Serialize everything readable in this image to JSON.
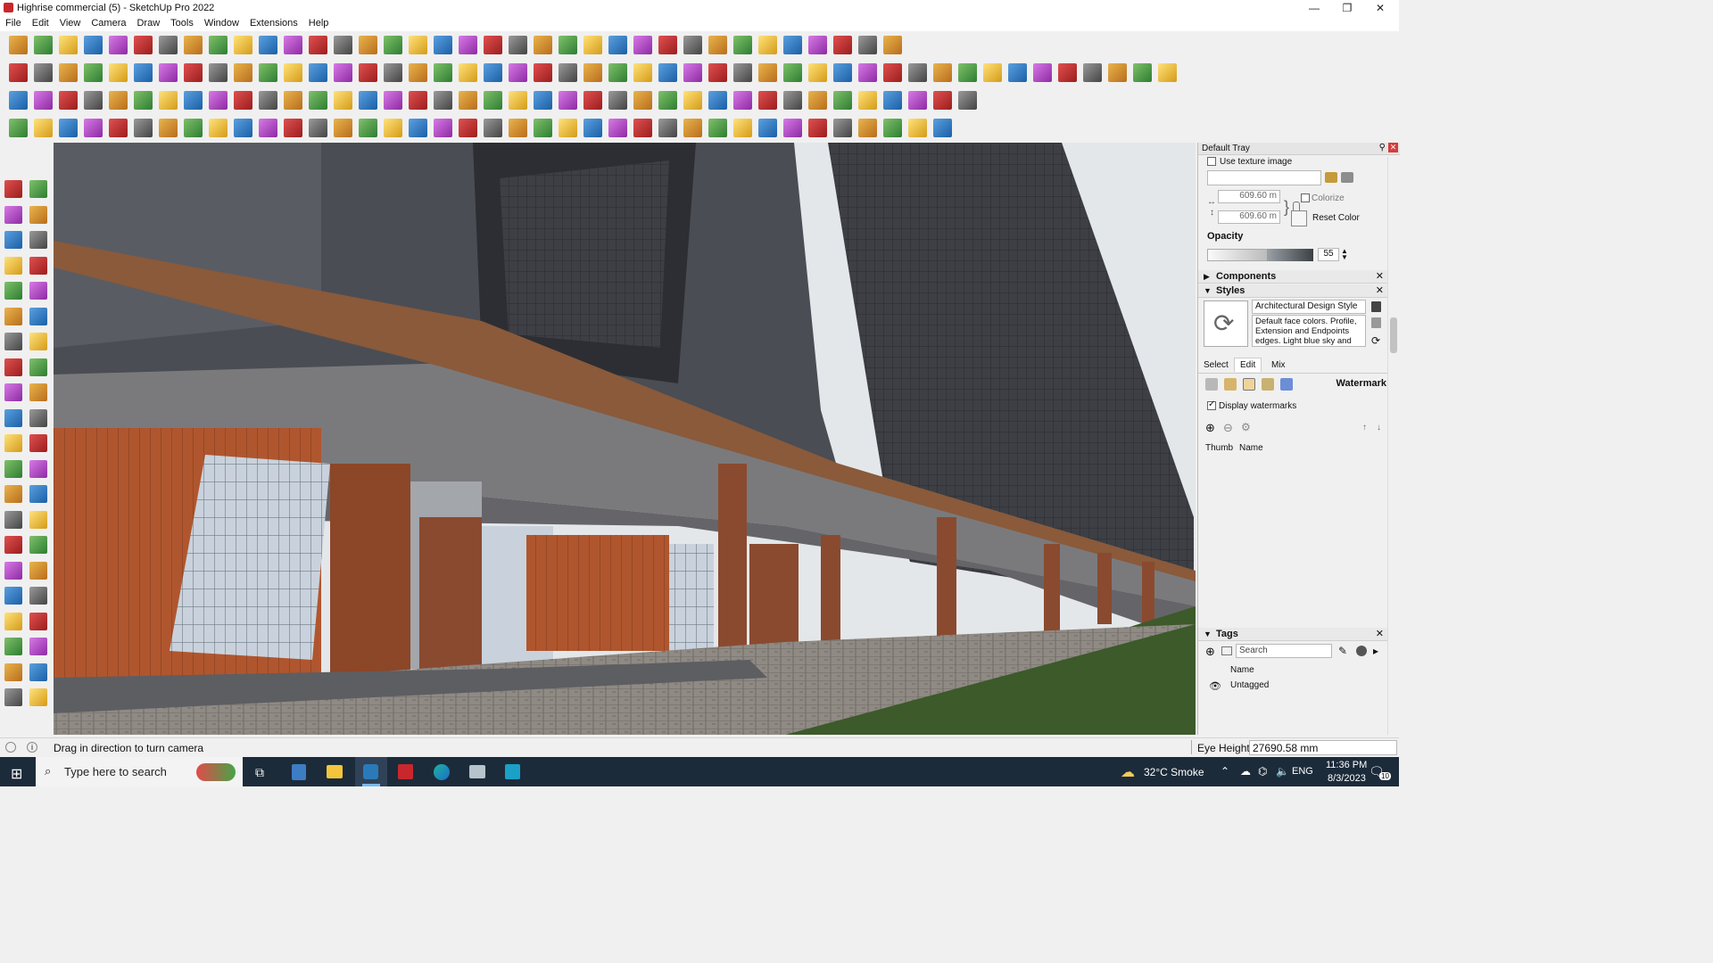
{
  "window": {
    "title": "Highrise commercial (5) - SketchUp Pro 2022",
    "controls": [
      "—",
      "❐",
      "✕"
    ]
  },
  "menu": [
    "File",
    "Edit",
    "View",
    "Camera",
    "Draw",
    "Tools",
    "Window",
    "Extensions",
    "Help"
  ],
  "tray": {
    "title": "Default Tray",
    "materials": {
      "use_texture_label": "Use texture image",
      "width_value": "609.60 m",
      "height_value": "609.60 m",
      "colorize_label": "Colorize",
      "reset_color_label": "Reset Color",
      "opacity_label": "Opacity",
      "opacity_value": "55"
    },
    "components_label": "Components",
    "styles": {
      "label": "Styles",
      "style_name": "Architectural Design Style",
      "description": "Default face colors. Profile, Extension and Endpoints edges. Light blue sky and gray",
      "tabs": [
        "Select",
        "Edit",
        "Mix"
      ],
      "section_label": "Watermark",
      "display_watermarks_label": "Display watermarks",
      "columns": [
        "Thumb",
        "Name"
      ]
    },
    "tags": {
      "label": "Tags",
      "search_placeholder": "Search",
      "name_header": "Name",
      "items": [
        "Untagged"
      ]
    }
  },
  "status": {
    "message": "Drag in direction to turn camera",
    "measure_label": "Eye Height",
    "measure_value": "27690.58 mm"
  },
  "taskbar": {
    "search_placeholder": "Type here to search",
    "weather": "32°C  Smoke",
    "language": "ENG",
    "time": "11:36 PM",
    "date": "8/3/2023",
    "notification_count": "10"
  },
  "colors": {
    "brick": "#8a4a2f",
    "sky": "#e4e7ea",
    "tower": "#4a4c52",
    "grass": "#3c5a2a",
    "taskbar": "#1c2b3a"
  }
}
